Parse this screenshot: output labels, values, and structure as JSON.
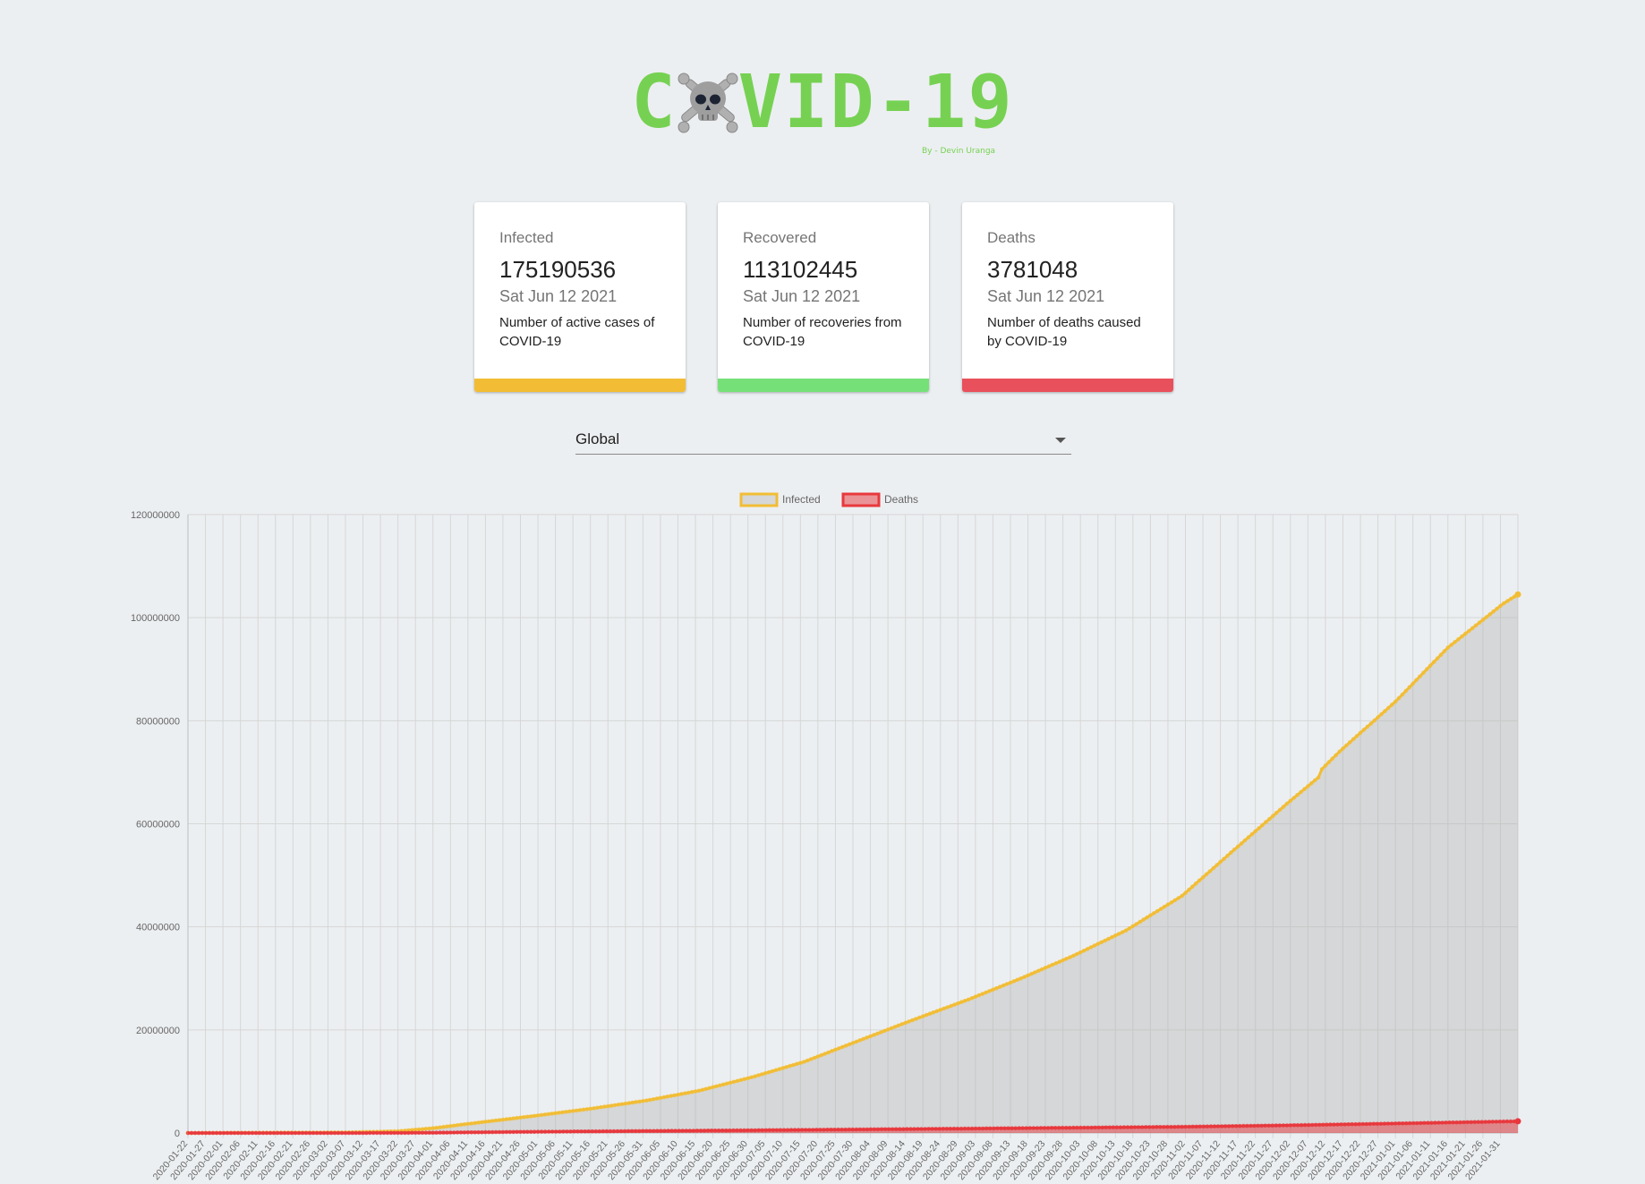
{
  "app": {
    "logo_text_left": "C",
    "logo_text_right": "VID-19",
    "logo_icon": "skull-crossbones-icon",
    "byline": "By - Devin Uranga",
    "brand_color": "#76d153"
  },
  "cards": [
    {
      "label": "Infected",
      "value": "175190536",
      "date": "Sat Jun 12 2021",
      "description": "Number of active cases of COVID-19",
      "bar_color": "#f2bd35"
    },
    {
      "label": "Recovered",
      "value": "113102445",
      "date": "Sat Jun 12 2021",
      "description": "Number of recoveries from COVID-19",
      "bar_color": "#76e078"
    },
    {
      "label": "Deaths",
      "value": "3781048",
      "date": "Sat Jun 12 2021",
      "description": "Number of deaths caused by COVID-19",
      "bar_color": "#e8505b"
    }
  ],
  "country_select": {
    "value": "Global"
  },
  "chart_data": {
    "type": "line",
    "legend": [
      "Infected",
      "Deaths"
    ],
    "legend_position": "top",
    "grid": true,
    "ylim": [
      0,
      120000000
    ],
    "y_ticks": [
      "120000000",
      "100000000",
      "80000000",
      "60000000",
      "40000000",
      "20000000",
      "0"
    ],
    "x_labels": [
      "2020-01-22",
      "2020-01-27",
      "2020-02-01",
      "2020-02-06",
      "2020-02-11",
      "2020-02-16",
      "2020-02-21",
      "2020-02-26",
      "2020-03-02",
      "2020-03-07",
      "2020-03-12",
      "2020-03-17",
      "2020-03-22",
      "2020-03-27",
      "2020-04-01",
      "2020-04-06",
      "2020-04-11",
      "2020-04-16",
      "2020-04-21",
      "2020-04-26",
      "2020-05-01",
      "2020-05-06",
      "2020-05-11",
      "2020-05-16",
      "2020-05-21",
      "2020-05-26",
      "2020-05-31",
      "2020-06-05",
      "2020-06-10",
      "2020-06-15",
      "2020-06-20",
      "2020-06-25",
      "2020-06-30",
      "2020-07-05",
      "2020-07-10",
      "2020-07-15",
      "2020-07-20",
      "2020-07-25",
      "2020-07-30",
      "2020-08-04",
      "2020-08-09",
      "2020-08-14",
      "2020-08-19",
      "2020-08-24",
      "2020-08-29",
      "2020-09-03",
      "2020-09-08",
      "2020-09-13",
      "2020-09-18",
      "2020-09-23",
      "2020-09-28",
      "2020-10-03",
      "2020-10-08",
      "2020-10-13",
      "2020-10-18",
      "2020-10-23",
      "2020-10-28",
      "2020-11-02",
      "2020-11-07",
      "2020-11-12",
      "2020-11-17",
      "2020-11-22",
      "2020-11-27",
      "2020-12-02",
      "2020-12-07",
      "2020-12-12",
      "2020-12-17",
      "2020-12-22",
      "2020-12-27",
      "2021-01-01",
      "2021-01-06",
      "2021-01-11",
      "2021-01-16",
      "2021-01-21",
      "2021-01-26",
      "2021-01-31"
    ],
    "series": [
      {
        "name": "Infected",
        "color": "#f2bd35",
        "fill": "rgba(180,180,180,0.42)",
        "x": [
          "2020-01-22",
          "2020-03-07",
          "2020-03-22",
          "2020-04-01",
          "2020-04-16",
          "2020-05-01",
          "2020-05-16",
          "2020-06-01",
          "2020-06-16",
          "2020-07-01",
          "2020-07-16",
          "2020-08-01",
          "2020-08-16",
          "2020-09-01",
          "2020-09-16",
          "2020-10-01",
          "2020-10-16",
          "2020-11-01",
          "2020-11-16",
          "2020-12-01",
          "2020-12-10",
          "2020-12-11",
          "2020-12-16",
          "2021-01-01",
          "2021-01-16",
          "2021-02-01",
          "2021-02-05"
        ],
        "values": [
          0,
          110000,
          340000,
          930000,
          2180000,
          3400000,
          4700000,
          6300000,
          8200000,
          10800000,
          13800000,
          18000000,
          21900000,
          25900000,
          30000000,
          34400000,
          39300000,
          46000000,
          55000000,
          63900000,
          69000000,
          70600000,
          74000000,
          83700000,
          94200000,
          102800000,
          104500000
        ]
      },
      {
        "name": "Deaths",
        "color": "#e8383d",
        "fill": "rgba(232,56,61,0.5)",
        "x": [
          "2020-01-22",
          "2020-03-07",
          "2020-03-22",
          "2020-04-01",
          "2020-04-16",
          "2020-05-01",
          "2020-06-01",
          "2020-07-01",
          "2020-08-01",
          "2020-09-01",
          "2020-10-01",
          "2020-11-01",
          "2020-12-01",
          "2021-01-01",
          "2021-02-05"
        ],
        "values": [
          0,
          3600,
          15000,
          50000,
          150000,
          240000,
          380000,
          520000,
          690000,
          850000,
          1020000,
          1200000,
          1480000,
          1840000,
          2270000
        ]
      }
    ]
  }
}
